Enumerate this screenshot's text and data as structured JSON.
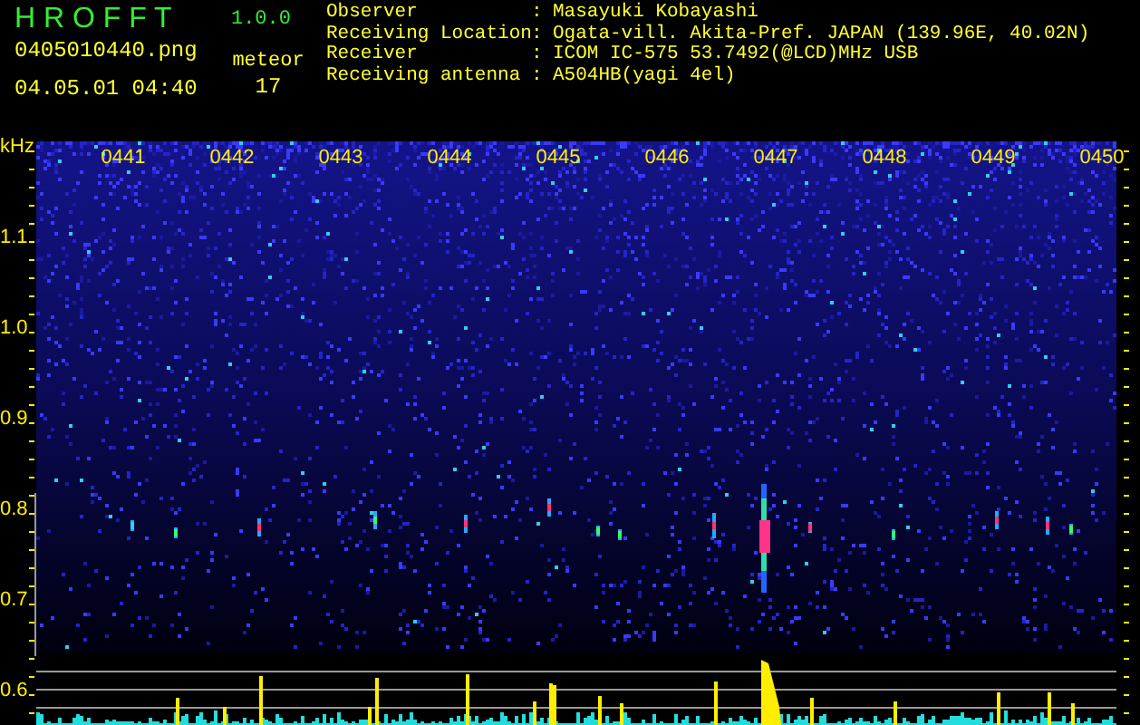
{
  "header": {
    "title": "H R O F F T",
    "version": "1.0.0",
    "filename": "0405010440.png",
    "meteor_label": "meteor",
    "datetime": "04.05.01 04:40",
    "meteor_count": "17"
  },
  "info": [
    {
      "label": "Observer",
      "separator": ":",
      "value": "Masayuki Kobayashi"
    },
    {
      "label": "Receiving Location",
      "separator": ":",
      "value": "Ogata-vill. Akita-Pref. JAPAN (139.96E, 40.02N)"
    },
    {
      "label": "Receiver",
      "separator": ":",
      "value": "ICOM IC-575 53.7492(@LCD)MHz USB"
    },
    {
      "label": "Receiving antenna",
      "separator": ":",
      "value": "A504HB(yagi 4el)"
    }
  ],
  "spectrogram": {
    "frequency_unit": "kHz",
    "frequency_labels": [
      "1.1",
      "1.0",
      "0.9",
      "0.8",
      "0.7",
      "0.6"
    ],
    "time_labels": [
      "0441",
      "0442",
      "0443",
      "0444",
      "0445",
      "0446",
      "0447",
      "0448",
      "0449",
      "0450"
    ]
  }
}
